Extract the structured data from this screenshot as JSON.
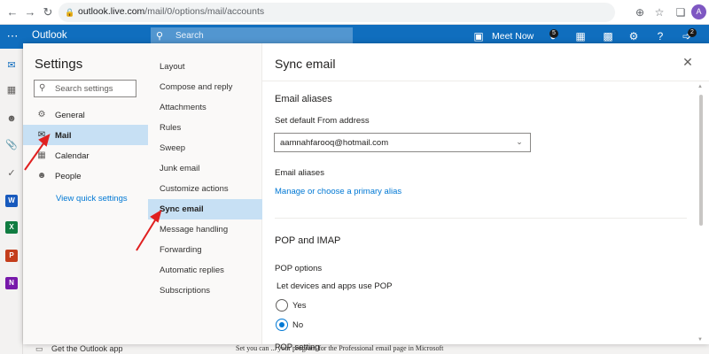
{
  "browser": {
    "url_host": "outlook.live.com",
    "url_path": "/mail/0/options/mail/accounts",
    "profile_initial": "A",
    "icons": [
      "back-icon",
      "forward-icon",
      "reload-icon",
      "lock-icon",
      "install-icon",
      "star-icon",
      "extensions-icon"
    ]
  },
  "outlook_header": {
    "app_name": "Outlook",
    "search_placeholder": "Search",
    "meet_now_label": "Meet Now",
    "badges": {
      "skype": "5",
      "updates": "2"
    }
  },
  "settings": {
    "title": "Settings",
    "search_placeholder": "Search settings",
    "categories": [
      {
        "label": "General",
        "icon": "gear-icon"
      },
      {
        "label": "Mail",
        "icon": "mail-icon",
        "selected": true
      },
      {
        "label": "Calendar",
        "icon": "calendar-icon"
      },
      {
        "label": "People",
        "icon": "people-icon"
      }
    ],
    "view_quick_settings": "View quick settings",
    "mail_subsections": [
      "Layout",
      "Compose and reply",
      "Attachments",
      "Rules",
      "Sweep",
      "Junk email",
      "Customize actions",
      "Sync email",
      "Message handling",
      "Forwarding",
      "Automatic replies",
      "Subscriptions"
    ],
    "selected_subsection": "Sync email"
  },
  "content": {
    "title": "Sync email",
    "email_aliases_heading": "Email aliases",
    "default_from_label": "Set default From address",
    "default_from_value": "aamnahfarooq@hotmail.com",
    "email_aliases_label": "Email aliases",
    "manage_alias_link": "Manage or choose a primary alias",
    "pop_imap_heading": "POP and IMAP",
    "pop_options_label": "POP options",
    "let_devices_label": "Let devices and apps use POP",
    "radio_yes": "Yes",
    "radio_no": "No",
    "radio_selected": "No",
    "pop_setting_label": "POP setting"
  },
  "background": {
    "get_app": "Get the Outlook app",
    "partial_text": "Set you can ... your program for the Professional email page in Microsoft"
  },
  "colors": {
    "outlook_blue": "#106ebe",
    "selection": "#c7e0f4",
    "link": "#0078d4",
    "annotation_red": "#e02020"
  }
}
